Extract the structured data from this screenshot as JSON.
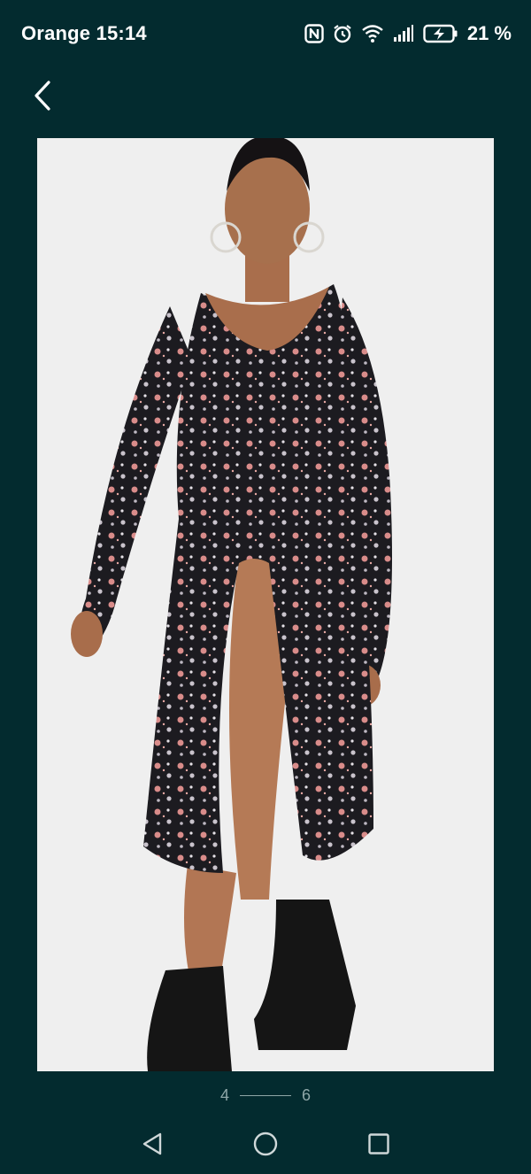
{
  "status_bar": {
    "carrier": "Orange",
    "time": "15:14",
    "battery_percent": "21 %",
    "icons": [
      "nfc-icon",
      "alarm-icon",
      "wifi-icon",
      "signal-icon",
      "battery-charging-icon"
    ]
  },
  "header": {
    "back_icon": "chevron-left-icon"
  },
  "gallery": {
    "image_description_kind": "photo",
    "pager": {
      "current": "4",
      "total": "6"
    }
  },
  "navigation": {
    "icons": [
      "back-triangle-icon",
      "home-circle-icon",
      "recents-square-icon"
    ]
  },
  "colors": {
    "background": "#032b2f",
    "text": "#ffffff",
    "pager_text": "#8fa7a8"
  }
}
